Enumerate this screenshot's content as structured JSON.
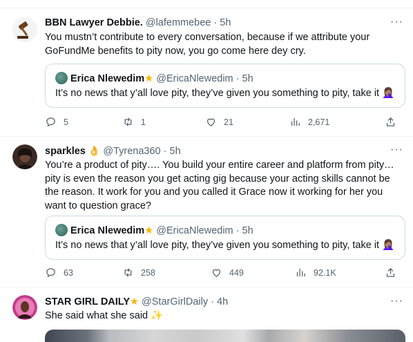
{
  "tweets": [
    {
      "name": "BBN Lawyer Debbie.",
      "handle": "@lafemmebee",
      "dot": "·",
      "time": "5h",
      "text": "You mustn’t contribute to every conversation, because if we attribute your GoFundMe benefits to pity now, you go come here dey cry.",
      "quote": {
        "name": "Erica Nlewedim",
        "handle": "@EricaNlewedim",
        "dot": "·",
        "time": "5h",
        "text": "It’s no news that y’all love pity, they’ve given you something to pity, take it"
      },
      "replies": "5",
      "reposts": "1",
      "likes": "21",
      "views": "2,671"
    },
    {
      "name": "sparkles",
      "handle": "@Tyrena360",
      "dot": "·",
      "time": "5h",
      "text": "You’re a product of pity…. You build your entire career and platform from pity… pity is even the reason you get acting gig because your acting skills cannot be the reason. It work for you and you called it Grace now it working for her you want to question grace?",
      "quote": {
        "name": "Erica Nlewedim",
        "handle": "@EricaNlewedim",
        "dot": "·",
        "time": "5h",
        "text": "It’s no news that y’all love pity, they’ve given you something to pity, take it"
      },
      "replies": "63",
      "reposts": "258",
      "likes": "449",
      "views": "92.1K"
    },
    {
      "name": "STAR GIRL DAILY",
      "handle": "@StarGirlDaily",
      "dot": "·",
      "time": "4h",
      "text": "She said what she said"
    }
  ],
  "icons": {
    "more": "more-icon",
    "reply": "reply-icon",
    "repost": "repost-icon",
    "like": "heart-icon",
    "views": "views-icon",
    "share": "share-icon"
  },
  "colors": {
    "text": "#0f1419",
    "secondary": "#536471",
    "border": "#cfd9de",
    "star": "#f7b500"
  }
}
